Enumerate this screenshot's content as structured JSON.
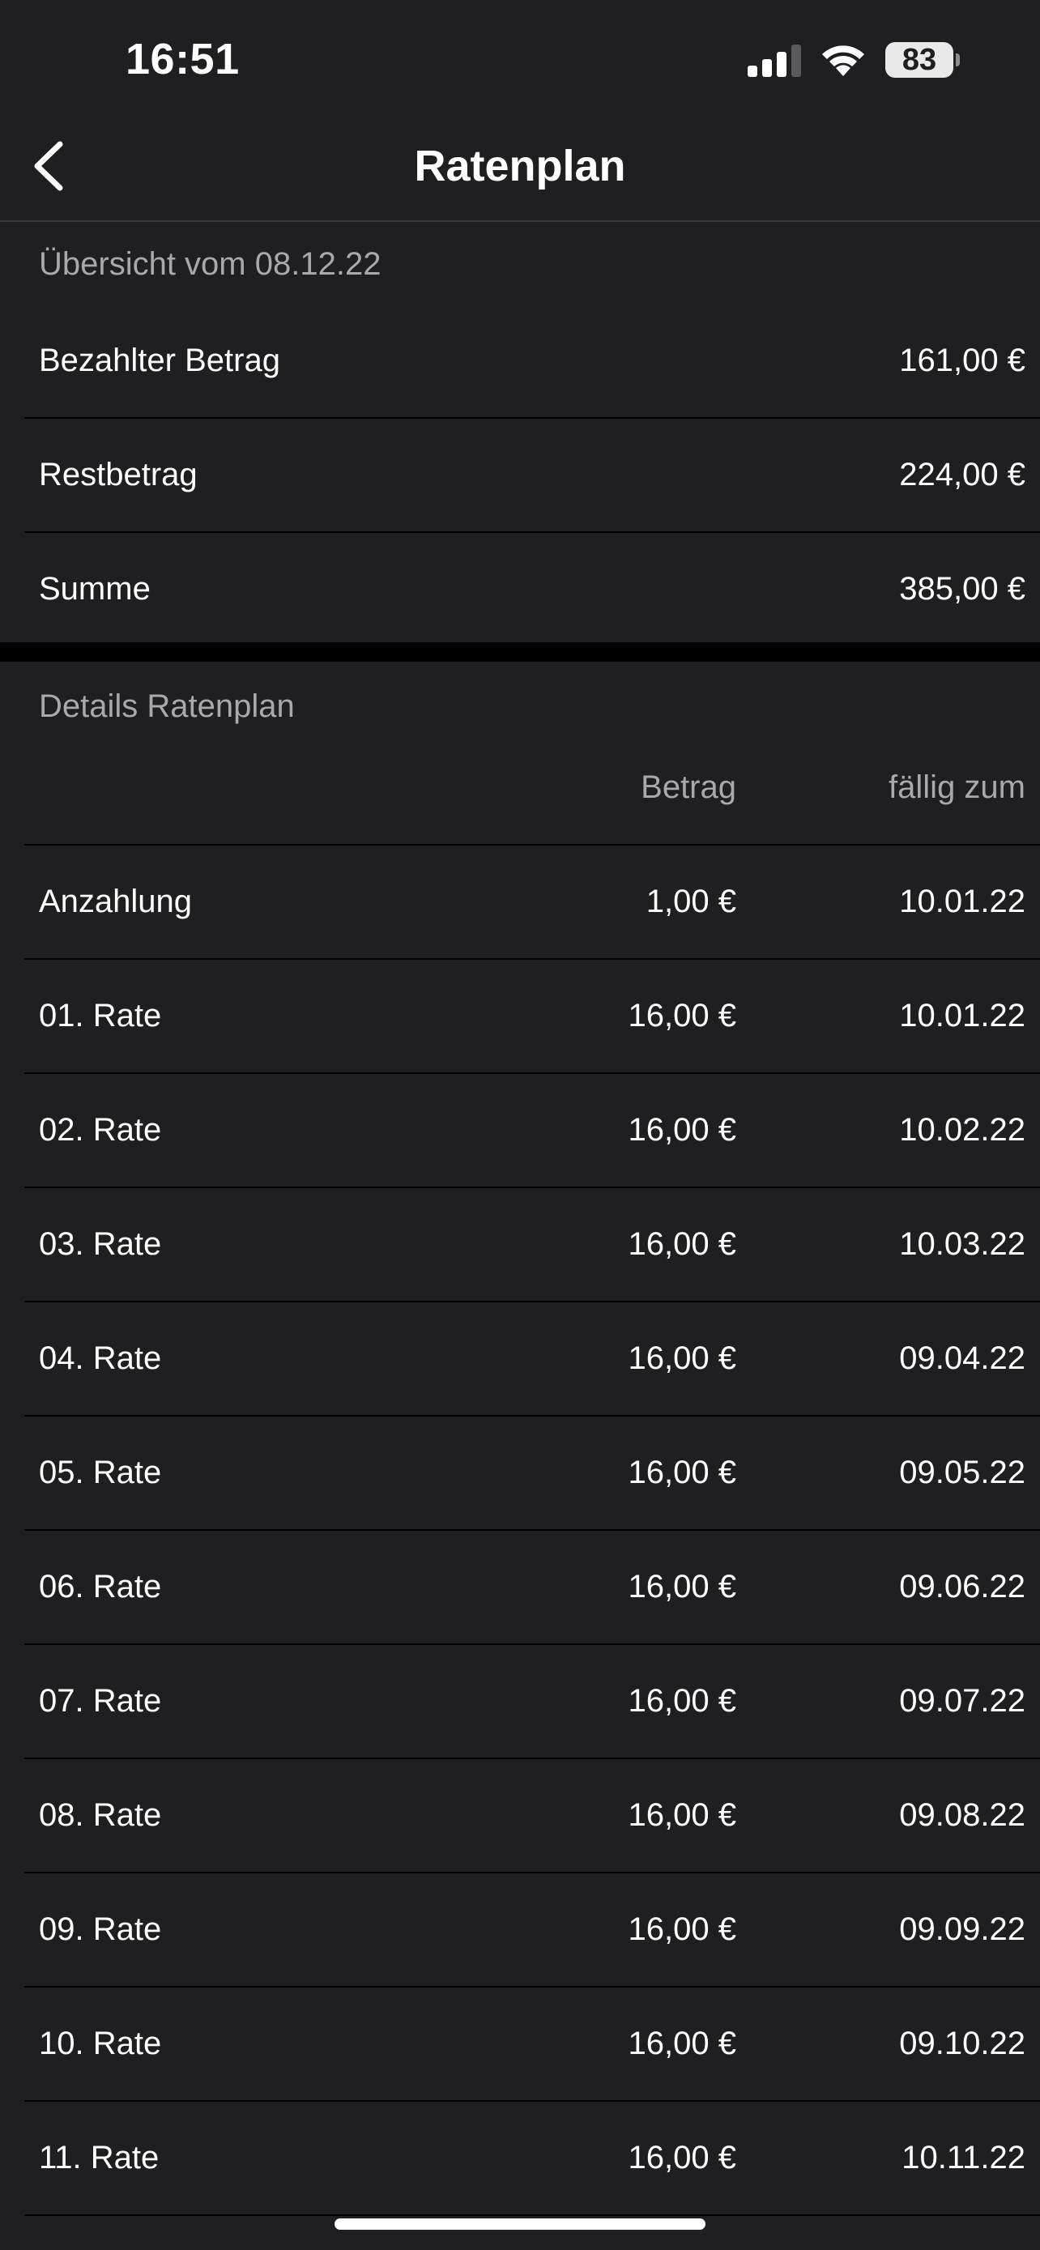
{
  "status_bar": {
    "time": "16:51",
    "battery_level": "83",
    "icons": [
      "signal-icon",
      "wifi-icon",
      "battery-icon"
    ]
  },
  "nav": {
    "title": "Ratenplan",
    "back_icon": "chevron-left-icon"
  },
  "overview": {
    "header": "Übersicht vom 08.12.22",
    "rows": [
      {
        "label": "Bezahlter Betrag",
        "value": "161,00 €"
      },
      {
        "label": "Restbetrag",
        "value": "224,00 €"
      },
      {
        "label": "Summe",
        "value": "385,00 €"
      }
    ]
  },
  "details": {
    "header": "Details Ratenplan",
    "columns": {
      "amount": "Betrag",
      "due": "fällig zum"
    },
    "rows": [
      {
        "label": "Anzahlung",
        "amount": "1,00 €",
        "due": "10.01.22"
      },
      {
        "label": "01. Rate",
        "amount": "16,00 €",
        "due": "10.01.22"
      },
      {
        "label": "02. Rate",
        "amount": "16,00 €",
        "due": "10.02.22"
      },
      {
        "label": "03. Rate",
        "amount": "16,00 €",
        "due": "10.03.22"
      },
      {
        "label": "04. Rate",
        "amount": "16,00 €",
        "due": "09.04.22"
      },
      {
        "label": "05. Rate",
        "amount": "16,00 €",
        "due": "09.05.22"
      },
      {
        "label": "06. Rate",
        "amount": "16,00 €",
        "due": "09.06.22"
      },
      {
        "label": "07. Rate",
        "amount": "16,00 €",
        "due": "09.07.22"
      },
      {
        "label": "08. Rate",
        "amount": "16,00 €",
        "due": "09.08.22"
      },
      {
        "label": "09. Rate",
        "amount": "16,00 €",
        "due": "09.09.22"
      },
      {
        "label": "10. Rate",
        "amount": "16,00 €",
        "due": "09.10.22"
      },
      {
        "label": "11. Rate",
        "amount": "16,00 €",
        "due": "10.11.22"
      }
    ]
  },
  "colors": {
    "background": "#1f1f21",
    "separator": "#000000",
    "secondary_text": "#a8a8ad",
    "primary_text": "#ffffff"
  }
}
